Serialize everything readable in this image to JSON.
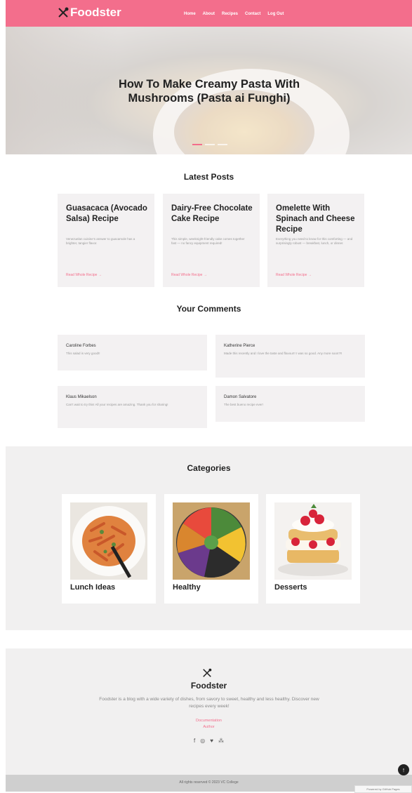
{
  "nav": {
    "brand": "Foodster",
    "links": [
      "Home",
      "About",
      "Recipes",
      "Contact",
      "Log Out"
    ]
  },
  "hero": {
    "title": "How To Make Creamy Pasta With Mushrooms (Pasta ai Funghi)"
  },
  "latest": {
    "title": "Latest Posts",
    "posts": [
      {
        "title": "Guasacaca (Avocado Salsa) Recipe",
        "desc": "Venezuelan cuisine’s answer to guacamole has a brighter, tangier flavor.",
        "link": "Read Whole Recipe →"
      },
      {
        "title": "Dairy-Free Chocolate Cake Recipe",
        "desc": "This simple, weeknight-friendly cake comes together fast — no fancy equipment required!",
        "link": "Read Whole Recipe →"
      },
      {
        "title": "Omelette With Spinach and Cheese Recipe",
        "desc": "Everything you need to know for this comforting — and surprisingly robust — breakfast, lunch, or dinner.",
        "link": "Read Whole Recipe →"
      }
    ]
  },
  "comments": {
    "title": "Your Comments",
    "items": [
      {
        "name": "Caroline Forbes",
        "text": "This salad is very good!!"
      },
      {
        "name": "Katherine Pierce",
        "text": "Made this recently and I love the taste and flavour!! I was so good. Any more soon?!!"
      },
      {
        "name": "Klaus Mikaelson",
        "text": "Can’t wait to try this! All your recipes are amazing. Thank you for sharing!"
      },
      {
        "name": "Damon Salvatore",
        "text": "The best bueno recipe ever!"
      }
    ]
  },
  "categories": {
    "title": "Categories",
    "items": [
      {
        "label": "Lunch Ideas"
      },
      {
        "label": "Healthy"
      },
      {
        "label": "Desserts"
      }
    ]
  },
  "footer": {
    "brand": "Foodster",
    "desc": "Foodster is a blog with a wide variety of dishes, from savory to sweet, healthy and less healthy. Discover new recipes every week!",
    "links": [
      "Documentation",
      "Author"
    ],
    "copyright": "All rights reserved © 2023 VC College",
    "badge": "Powered by GitHub Pages"
  },
  "colors": {
    "accent": "#f36e8c",
    "card_bg": "#f3f1f2",
    "section_bg": "#f1f0f0"
  },
  "icons": [
    "utensils-icon",
    "facebook-icon",
    "instagram-icon",
    "twitter-icon",
    "sitemap-icon",
    "arrow-up-icon"
  ]
}
